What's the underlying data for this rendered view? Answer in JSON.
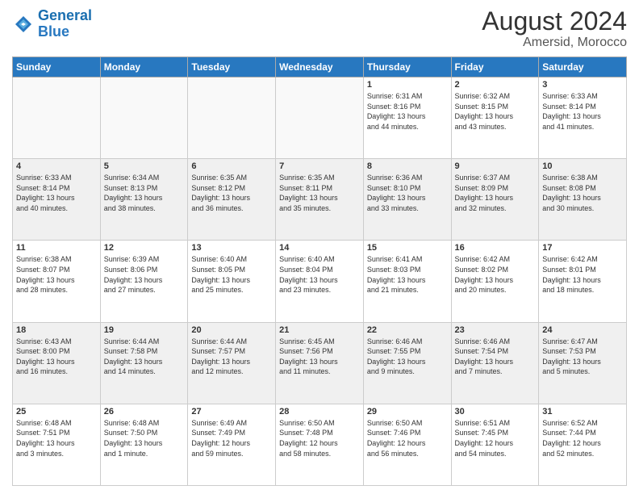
{
  "header": {
    "logo_line1": "General",
    "logo_line2": "Blue",
    "month_year": "August 2024",
    "location": "Amersid, Morocco"
  },
  "days_of_week": [
    "Sunday",
    "Monday",
    "Tuesday",
    "Wednesday",
    "Thursday",
    "Friday",
    "Saturday"
  ],
  "weeks": [
    [
      {
        "day": "",
        "info": ""
      },
      {
        "day": "",
        "info": ""
      },
      {
        "day": "",
        "info": ""
      },
      {
        "day": "",
        "info": ""
      },
      {
        "day": "1",
        "info": "Sunrise: 6:31 AM\nSunset: 8:16 PM\nDaylight: 13 hours\nand 44 minutes."
      },
      {
        "day": "2",
        "info": "Sunrise: 6:32 AM\nSunset: 8:15 PM\nDaylight: 13 hours\nand 43 minutes."
      },
      {
        "day": "3",
        "info": "Sunrise: 6:33 AM\nSunset: 8:14 PM\nDaylight: 13 hours\nand 41 minutes."
      }
    ],
    [
      {
        "day": "4",
        "info": "Sunrise: 6:33 AM\nSunset: 8:14 PM\nDaylight: 13 hours\nand 40 minutes."
      },
      {
        "day": "5",
        "info": "Sunrise: 6:34 AM\nSunset: 8:13 PM\nDaylight: 13 hours\nand 38 minutes."
      },
      {
        "day": "6",
        "info": "Sunrise: 6:35 AM\nSunset: 8:12 PM\nDaylight: 13 hours\nand 36 minutes."
      },
      {
        "day": "7",
        "info": "Sunrise: 6:35 AM\nSunset: 8:11 PM\nDaylight: 13 hours\nand 35 minutes."
      },
      {
        "day": "8",
        "info": "Sunrise: 6:36 AM\nSunset: 8:10 PM\nDaylight: 13 hours\nand 33 minutes."
      },
      {
        "day": "9",
        "info": "Sunrise: 6:37 AM\nSunset: 8:09 PM\nDaylight: 13 hours\nand 32 minutes."
      },
      {
        "day": "10",
        "info": "Sunrise: 6:38 AM\nSunset: 8:08 PM\nDaylight: 13 hours\nand 30 minutes."
      }
    ],
    [
      {
        "day": "11",
        "info": "Sunrise: 6:38 AM\nSunset: 8:07 PM\nDaylight: 13 hours\nand 28 minutes."
      },
      {
        "day": "12",
        "info": "Sunrise: 6:39 AM\nSunset: 8:06 PM\nDaylight: 13 hours\nand 27 minutes."
      },
      {
        "day": "13",
        "info": "Sunrise: 6:40 AM\nSunset: 8:05 PM\nDaylight: 13 hours\nand 25 minutes."
      },
      {
        "day": "14",
        "info": "Sunrise: 6:40 AM\nSunset: 8:04 PM\nDaylight: 13 hours\nand 23 minutes."
      },
      {
        "day": "15",
        "info": "Sunrise: 6:41 AM\nSunset: 8:03 PM\nDaylight: 13 hours\nand 21 minutes."
      },
      {
        "day": "16",
        "info": "Sunrise: 6:42 AM\nSunset: 8:02 PM\nDaylight: 13 hours\nand 20 minutes."
      },
      {
        "day": "17",
        "info": "Sunrise: 6:42 AM\nSunset: 8:01 PM\nDaylight: 13 hours\nand 18 minutes."
      }
    ],
    [
      {
        "day": "18",
        "info": "Sunrise: 6:43 AM\nSunset: 8:00 PM\nDaylight: 13 hours\nand 16 minutes."
      },
      {
        "day": "19",
        "info": "Sunrise: 6:44 AM\nSunset: 7:58 PM\nDaylight: 13 hours\nand 14 minutes."
      },
      {
        "day": "20",
        "info": "Sunrise: 6:44 AM\nSunset: 7:57 PM\nDaylight: 13 hours\nand 12 minutes."
      },
      {
        "day": "21",
        "info": "Sunrise: 6:45 AM\nSunset: 7:56 PM\nDaylight: 13 hours\nand 11 minutes."
      },
      {
        "day": "22",
        "info": "Sunrise: 6:46 AM\nSunset: 7:55 PM\nDaylight: 13 hours\nand 9 minutes."
      },
      {
        "day": "23",
        "info": "Sunrise: 6:46 AM\nSunset: 7:54 PM\nDaylight: 13 hours\nand 7 minutes."
      },
      {
        "day": "24",
        "info": "Sunrise: 6:47 AM\nSunset: 7:53 PM\nDaylight: 13 hours\nand 5 minutes."
      }
    ],
    [
      {
        "day": "25",
        "info": "Sunrise: 6:48 AM\nSunset: 7:51 PM\nDaylight: 13 hours\nand 3 minutes."
      },
      {
        "day": "26",
        "info": "Sunrise: 6:48 AM\nSunset: 7:50 PM\nDaylight: 13 hours\nand 1 minute."
      },
      {
        "day": "27",
        "info": "Sunrise: 6:49 AM\nSunset: 7:49 PM\nDaylight: 12 hours\nand 59 minutes."
      },
      {
        "day": "28",
        "info": "Sunrise: 6:50 AM\nSunset: 7:48 PM\nDaylight: 12 hours\nand 58 minutes."
      },
      {
        "day": "29",
        "info": "Sunrise: 6:50 AM\nSunset: 7:46 PM\nDaylight: 12 hours\nand 56 minutes."
      },
      {
        "day": "30",
        "info": "Sunrise: 6:51 AM\nSunset: 7:45 PM\nDaylight: 12 hours\nand 54 minutes."
      },
      {
        "day": "31",
        "info": "Sunrise: 6:52 AM\nSunset: 7:44 PM\nDaylight: 12 hours\nand 52 minutes."
      }
    ]
  ]
}
